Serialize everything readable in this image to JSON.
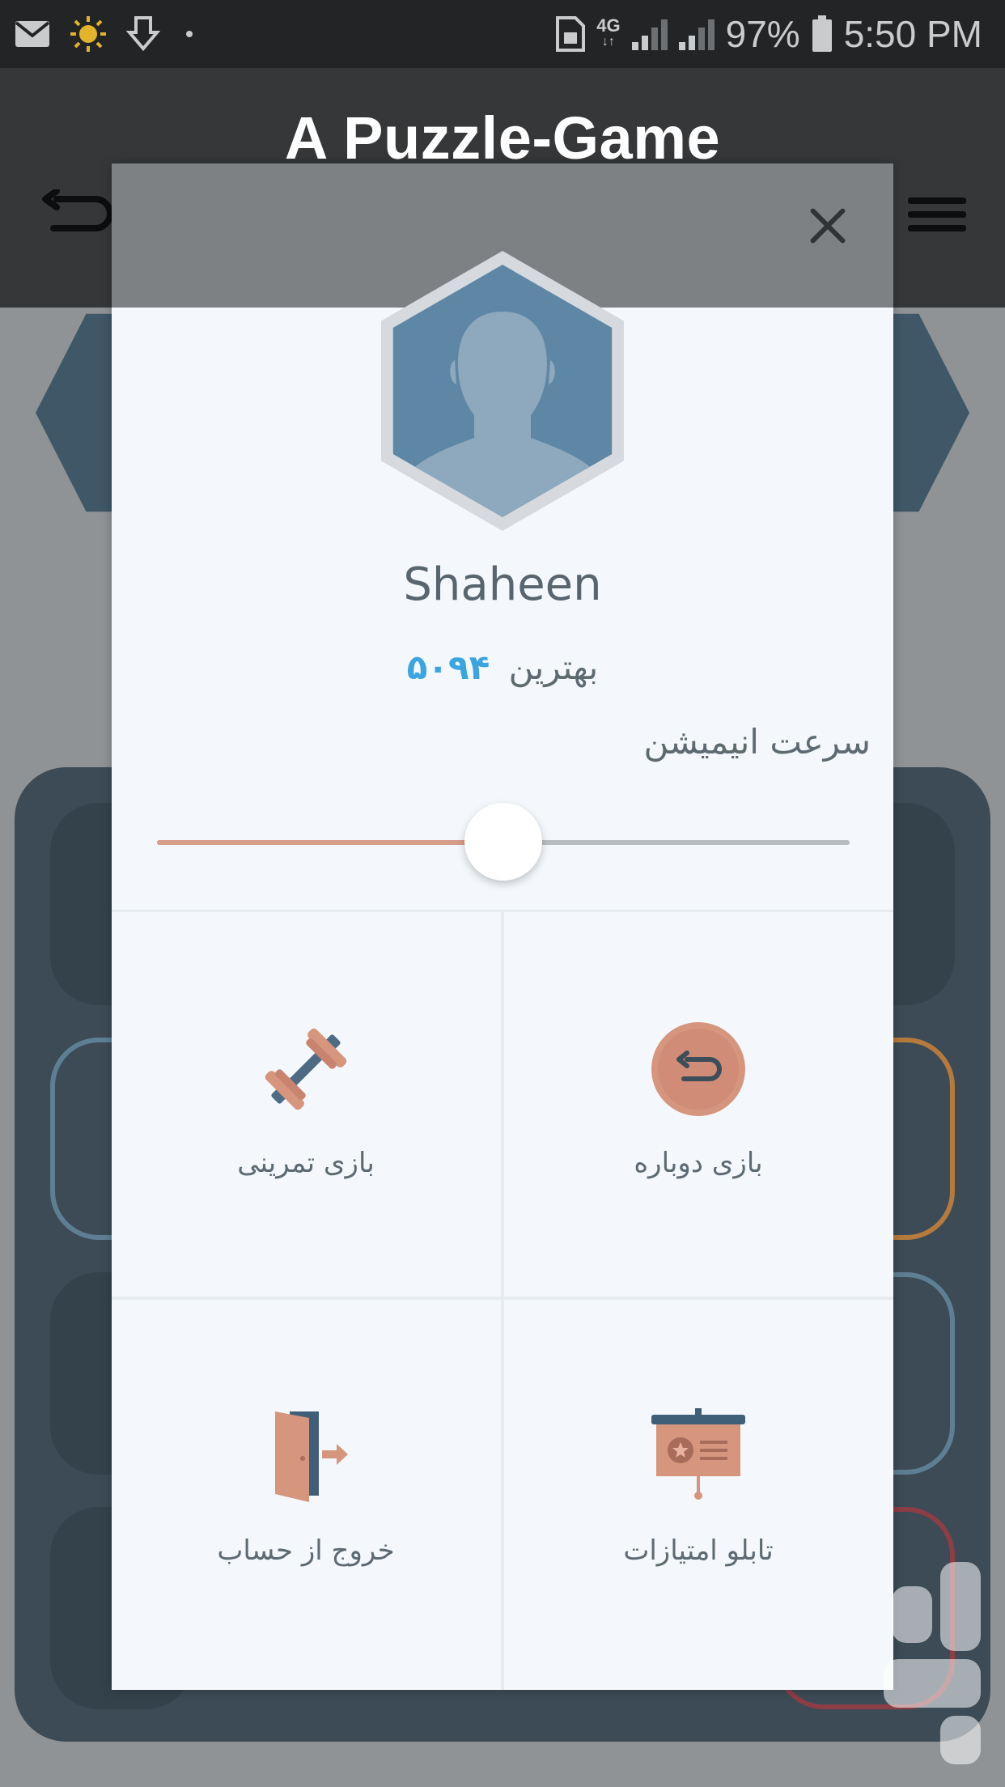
{
  "status_bar": {
    "battery_percent": "97%",
    "time": "5:50 PM",
    "network": "4G",
    "icons": [
      "mail-icon",
      "sun-icon",
      "download-icon",
      "dot-icon",
      "sim-icon",
      "signal-icon",
      "battery-icon"
    ]
  },
  "banner": {
    "title": "A Puzzle-Game"
  },
  "modal": {
    "username": "Shaheen",
    "best_label": "بهترین",
    "best_score": "۵۰۹۴",
    "speed_label": "سرعت انیمیشن",
    "speed_value_fraction": 0.5,
    "actions": [
      {
        "id": "practice",
        "label": "بازی تمرینی",
        "icon": "dumbbell-icon"
      },
      {
        "id": "replay",
        "label": "بازی دوباره",
        "icon": "replay-icon"
      },
      {
        "id": "logout",
        "label": "خروج از حساب",
        "icon": "exit-door-icon"
      },
      {
        "id": "leaderboard",
        "label": "تابلو امتیازات",
        "icon": "scoreboard-icon"
      }
    ]
  },
  "colors": {
    "accent_score": "#3ba4e1",
    "slider_fill": "#d79c8b",
    "icon_copper": "#d6957d",
    "icon_slate": "#4e6b84"
  }
}
